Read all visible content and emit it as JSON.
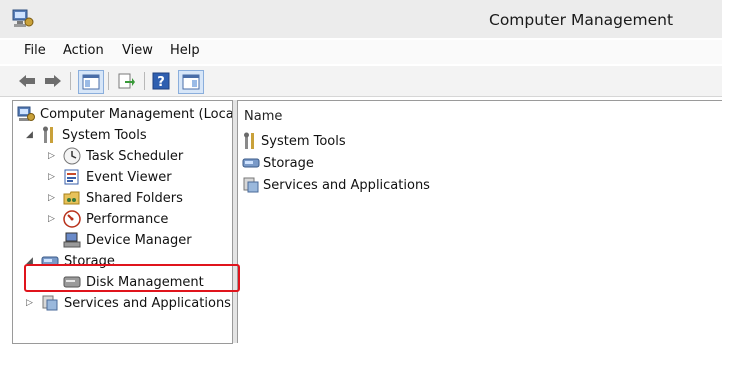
{
  "window": {
    "title": "Computer Management"
  },
  "menu": {
    "file": "File",
    "action": "Action",
    "view": "View",
    "help": "Help"
  },
  "tree": {
    "root": "Computer Management (Local",
    "system_tools": "System Tools",
    "task_scheduler": "Task Scheduler",
    "event_viewer": "Event Viewer",
    "shared_folders": "Shared Folders",
    "performance": "Performance",
    "device_manager": "Device Manager",
    "storage": "Storage",
    "disk_management": "Disk Management",
    "services_apps": "Services and Applications"
  },
  "list": {
    "column_name": "Name",
    "items": [
      "System Tools",
      "Storage",
      "Services and Applications"
    ]
  },
  "colors": {
    "highlight": "#e0141c",
    "titlebar": "#ececec"
  },
  "icons": {
    "title": "computer-management-icon",
    "back": "arrow-left-icon",
    "forward": "arrow-right-icon",
    "show_hide_tree": "console-tree-icon",
    "export": "export-list-icon",
    "help": "help-icon",
    "show_action_pane": "action-pane-icon"
  }
}
